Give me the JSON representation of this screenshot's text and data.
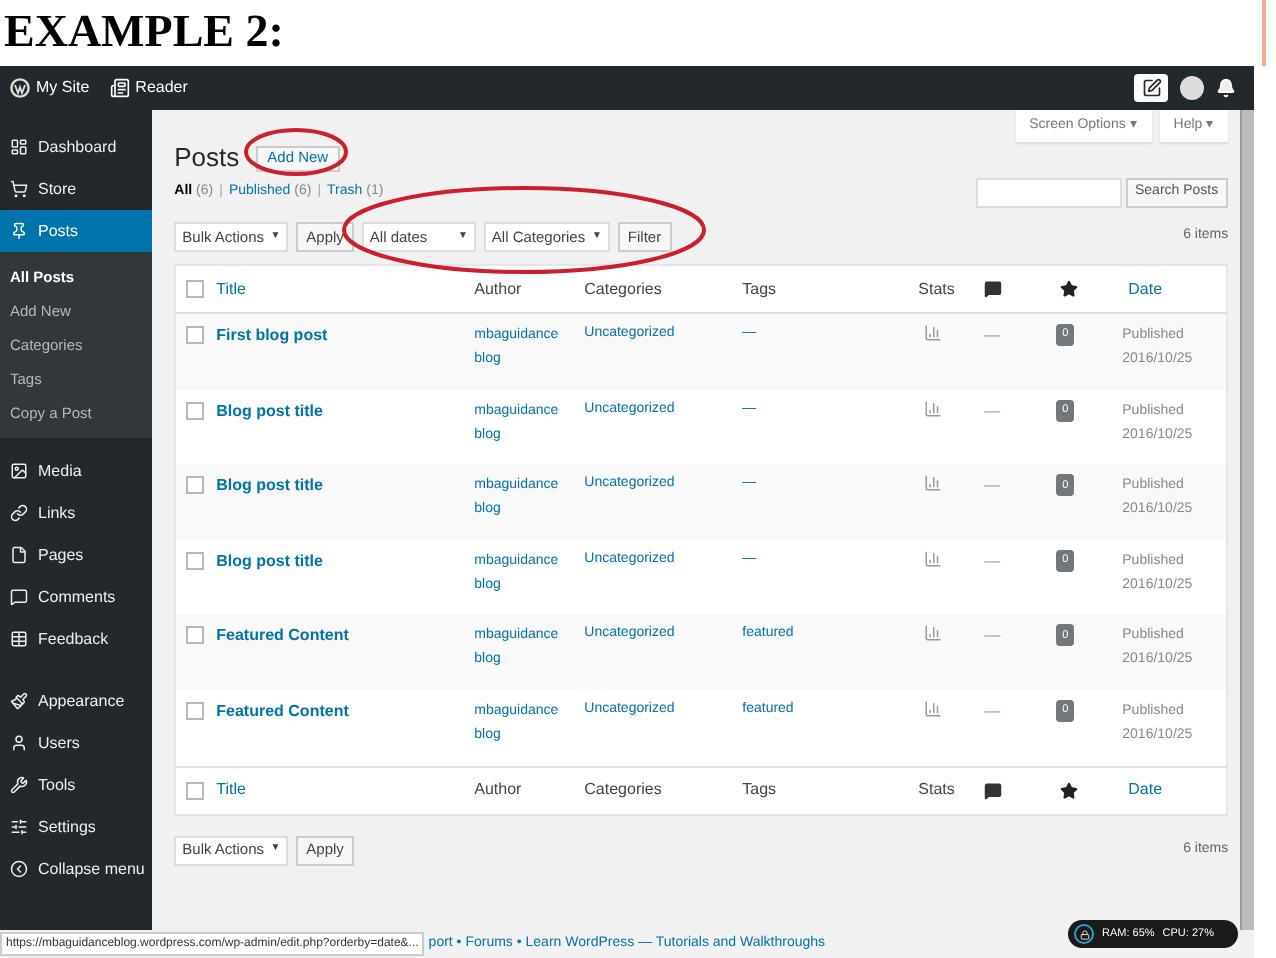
{
  "slide_title": "EXAMPLE 2:",
  "admin_bar": {
    "items": [
      "My Site",
      "Reader"
    ]
  },
  "sidebar": {
    "items": [
      {
        "label": "Dashboard",
        "selected": false
      },
      {
        "label": "Store",
        "selected": false
      },
      {
        "label": "Posts",
        "selected": true,
        "children": [
          {
            "label": "All Posts",
            "selected": true
          },
          {
            "label": "Add New",
            "selected": false
          },
          {
            "label": "Categories",
            "selected": false
          },
          {
            "label": "Tags",
            "selected": false
          },
          {
            "label": "Copy a Post",
            "selected": false
          }
        ]
      },
      {
        "label": "Media",
        "selected": false
      },
      {
        "label": "Links",
        "selected": false
      },
      {
        "label": "Pages",
        "selected": false
      },
      {
        "label": "Comments",
        "selected": false
      },
      {
        "label": "Feedback",
        "selected": false
      },
      {
        "label": "Appearance",
        "selected": false
      },
      {
        "label": "Users",
        "selected": false
      },
      {
        "label": "Tools",
        "selected": false
      },
      {
        "label": "Settings",
        "selected": false
      },
      {
        "label": "Collapse menu",
        "selected": false
      }
    ]
  },
  "top_tabs": [
    "Screen Options ▾",
    "Help ▾"
  ],
  "heading": "Posts",
  "add_new": "Add New",
  "filters": [
    {
      "label": "All",
      "count": "(6)",
      "selected": true
    },
    {
      "separator": "|",
      "label": "Published",
      "count": "(6)",
      "selected": false
    },
    {
      "separator": "|",
      "label": "Trash",
      "count": "(1)",
      "selected": false
    }
  ],
  "search_button": "Search Posts",
  "toolbar_top": {
    "bulk_actions": {
      "label": "Bulk Actions",
      "arrow": "▼"
    },
    "apply": "Apply",
    "dates": {
      "label": "All dates",
      "arrow": "▼"
    },
    "categories": {
      "label": "All Categories",
      "arrow": "▼"
    },
    "filter": "Filter",
    "items_count": "6 items"
  },
  "table": {
    "header": {
      "checked": false,
      "columns": [
        "Title",
        "Author",
        "Categories",
        "Tags",
        "Stats",
        "Date"
      ]
    },
    "footer": {
      "checked": false,
      "columns": [
        "Title",
        "Author",
        "Categories",
        "Tags",
        "Stats",
        "Date"
      ]
    },
    "rows": [
      {
        "title": "First blog post",
        "author": "mbaguidanceblog",
        "category": "Uncategorized",
        "tags": "—",
        "comments": "—",
        "likes": "0",
        "status": "Published",
        "date": "2016/10/25",
        "checked": false
      },
      {
        "title": "Blog post title",
        "author": "mbaguidanceblog",
        "category": "Uncategorized",
        "tags": "—",
        "comments": "—",
        "likes": "0",
        "status": "Published",
        "date": "2016/10/25",
        "checked": false
      },
      {
        "title": "Blog post title",
        "author": "mbaguidanceblog",
        "category": "Uncategorized",
        "tags": "—",
        "comments": "—",
        "likes": "0",
        "status": "Published",
        "date": "2016/10/25",
        "checked": false
      },
      {
        "title": "Blog post title",
        "author": "mbaguidanceblog",
        "category": "Uncategorized",
        "tags": "—",
        "comments": "—",
        "likes": "0",
        "status": "Published",
        "date": "2016/10/25",
        "checked": false
      },
      {
        "title": "Featured Content",
        "author": "mbaguidanceblog",
        "category": "Uncategorized",
        "tags": "featured",
        "comments": "—",
        "likes": "0",
        "status": "Published",
        "date": "2016/10/25",
        "checked": false
      },
      {
        "title": "Featured Content",
        "author": "mbaguidanceblog",
        "category": "Uncategorized",
        "tags": "featured",
        "comments": "—",
        "likes": "0",
        "status": "Published",
        "date": "2016/10/25",
        "checked": false
      }
    ]
  },
  "toolbar_bottom": {
    "bulk_actions": {
      "label": "Bulk Actions",
      "arrow": "▼"
    },
    "apply": "Apply",
    "items_count": "6 items"
  },
  "status_url": "https://mbaguidanceblog.wordpress.com/wp-admin/edit.php?orderby=date&...",
  "footer_text": "port • Forums • Learn WordPress — Tutorials and Walkthroughs",
  "monitor": {
    "ram": "RAM: 65%",
    "cpu": "CPU: 27%"
  }
}
